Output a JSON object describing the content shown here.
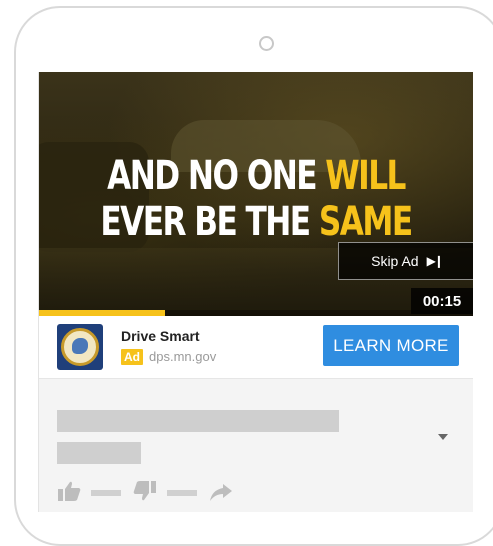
{
  "video": {
    "headline_line1_white": "AND NO ONE ",
    "headline_line1_yellow": "WILL",
    "headline_line2_white": "EVER BE THE ",
    "headline_line2_yellow": "SAME",
    "skip_label": "Skip Ad",
    "skip_icon": "skip-next-icon",
    "timer": "00:15",
    "progress_fraction": 0.29
  },
  "ad": {
    "advertiser": "Drive Smart",
    "badge": "Ad",
    "domain": "dps.mn.gov",
    "cta": "LEARN MORE",
    "logo_icon": "minnesota-dps-seal-icon"
  },
  "colors": {
    "accent_yellow": "#f6c21b",
    "cta_blue": "#2f8de0",
    "placeholder_gray": "#cfcfcf"
  },
  "icons": {
    "expand": "chevron-down-icon",
    "like": "thumbs-up-icon",
    "dislike": "thumbs-down-icon",
    "share": "share-arrow-icon"
  }
}
